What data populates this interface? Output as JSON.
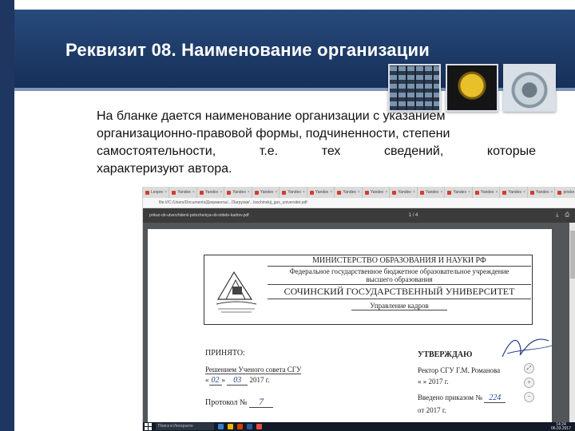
{
  "slide": {
    "title": "Реквизит 08. Наименование организации",
    "body_lines": [
      "На бланке дается наименование организации с указанием",
      "организационно-правовой формы, подчиненности, степени",
      "самостоятельности, т.е. тех сведений, которые",
      "характеризуют автора."
    ],
    "thumbnails": [
      "keyboard-image",
      "headphones-image",
      "speaker-image"
    ]
  },
  "browser": {
    "tabs": [
      "Lexpro",
      "Yandex",
      "Yandex",
      "Yandex",
      "Yandex",
      "Yandex",
      "Yandex",
      "Yandex",
      "Yandex",
      "Yandex",
      "Yandex",
      "Yandex",
      "Yandex",
      "Yandex",
      "Yandex",
      "pristor"
    ],
    "url": "file:///C:/Users/Documents/Документы/.../Загрузки/.../sochinskij_gos_universitet.pdf",
    "pdf_filename": "prikaz-ob-utverzhdenii-polozheniya-ob-otdele-kadrov.pdf",
    "page_indicator": "1 / 4"
  },
  "document": {
    "ministry": "МИНИСТЕРСТВО ОБРАЗОВАНИЯ И НАУКИ РФ",
    "fed_line1": "Федеральное государственное бюджетное образовательное учреждение",
    "fed_line2": "высшего образования",
    "university": "СОЧИНСКИЙ ГОСУДАРСТВЕННЫЙ УНИВЕРСИТЕТ",
    "department": "Управление кадров",
    "accepted": "ПРИНЯТО:",
    "decision": "Решением Ученого совета СГУ",
    "date_prefix": "«",
    "date_day": "02",
    "date_mid": "»",
    "date_month": "03",
    "date_year": "2017 г.",
    "protocol": "Протокол №",
    "protocol_num": "7",
    "approve": "УТВЕРЖДАЮ",
    "rector": "Ректор СГУ   Г.М. Романова",
    "rector_date": "«       »            2017 г.",
    "order": "Введено приказом №",
    "order_num": "224",
    "order_from": "от          2017 г.",
    "logo_text": "СОЧИНСКИЙ ГОСУДАРСТВЕННЫЙ УНИВЕРСИТЕТ"
  },
  "taskbar": {
    "search_placeholder": "Поиск в Интернете",
    "time": "14:24",
    "date": "06.03.2017"
  },
  "colors": {
    "header_bg": "#1d3a66",
    "pdf_toolbar": "#3b3b3b",
    "handwriting": "#2a3d8c"
  }
}
